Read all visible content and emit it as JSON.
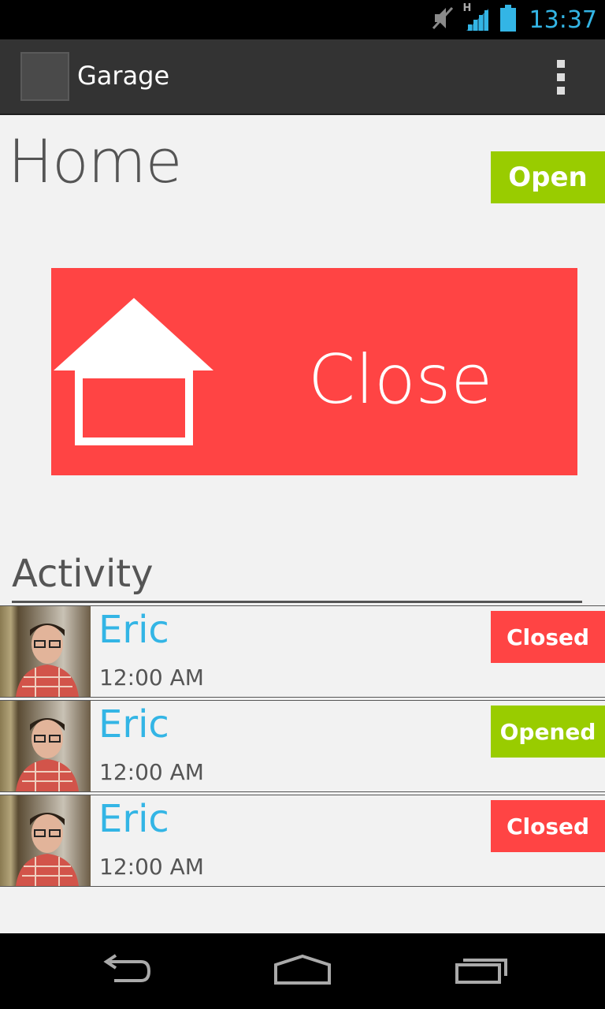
{
  "status_bar": {
    "time": "13:37",
    "network_label": "H",
    "icons": [
      "mute-icon",
      "signal-icon",
      "battery-icon"
    ]
  },
  "action_bar": {
    "title": "Garage",
    "menu_icon": "overflow-menu-icon"
  },
  "main": {
    "title": "Home",
    "door_status": "Open",
    "door_status_color": "#99cc00",
    "action_button": {
      "label": "Close",
      "icon": "garage-door-icon",
      "color": "#ff4444"
    }
  },
  "activity": {
    "header": "Activity",
    "items": [
      {
        "name": "Eric",
        "time": "12:00 AM",
        "status": "Closed",
        "status_color": "#ff4444"
      },
      {
        "name": "Eric",
        "time": "12:00 AM",
        "status": "Opened",
        "status_color": "#99cc00"
      },
      {
        "name": "Eric",
        "time": "12:00 AM",
        "status": "Closed",
        "status_color": "#ff4444"
      }
    ]
  },
  "nav_bar": {
    "icons": [
      "back-icon",
      "home-icon",
      "recent-apps-icon"
    ]
  },
  "colors": {
    "accent_blue": "#33b5e5",
    "green": "#99cc00",
    "red": "#ff4444"
  }
}
